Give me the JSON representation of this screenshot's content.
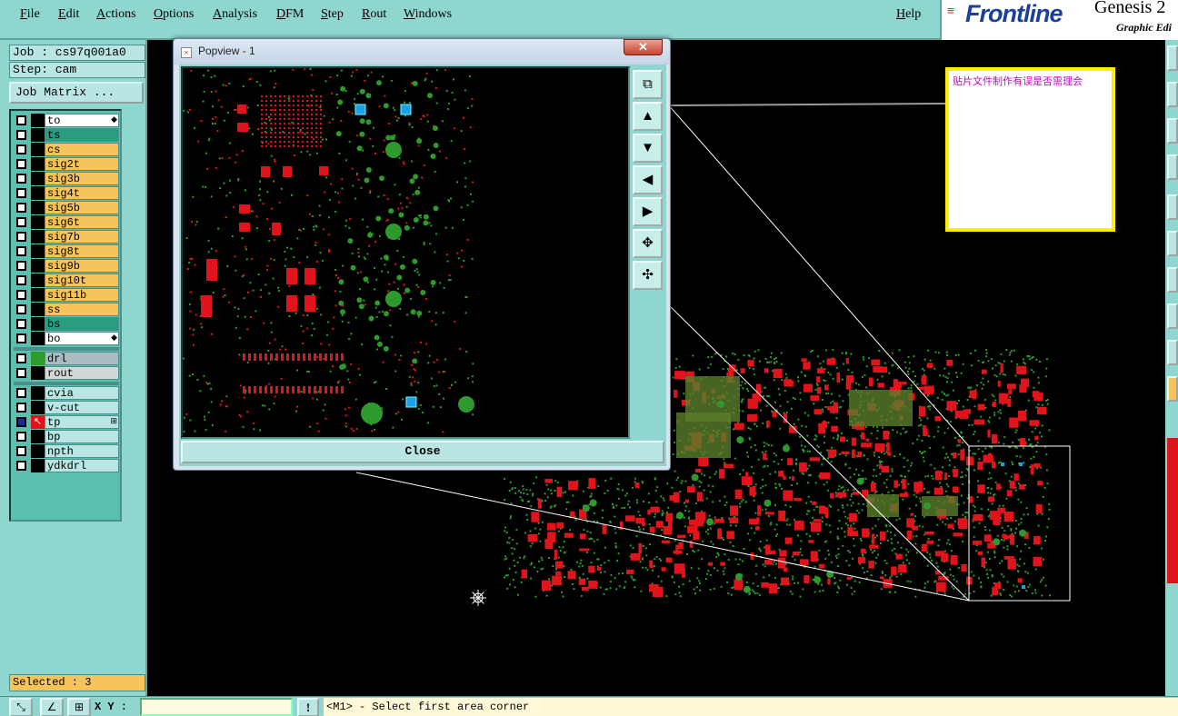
{
  "menubar": {
    "items": [
      "File",
      "Edit",
      "Actions",
      "Options",
      "Analysis",
      "DFM",
      "Step",
      "Rout",
      "Windows"
    ],
    "help": "Help"
  },
  "brand": {
    "logo": "Frontline",
    "product": "Genesis 2",
    "subtitle": "Graphic Edi"
  },
  "left_panel": {
    "job": "Job : cs97q001a0",
    "step": "Step: cam",
    "job_matrix_button": "Job Matrix ...",
    "layers_group1": [
      {
        "name": "to",
        "color": "#ffffff",
        "mark": "◆"
      },
      {
        "name": "ts",
        "color": "#2a9d80"
      },
      {
        "name": "cs",
        "color": "#f7c45b"
      },
      {
        "name": "sig2t",
        "color": "#f7c45b"
      },
      {
        "name": "sig3b",
        "color": "#f7c45b"
      },
      {
        "name": "sig4t",
        "color": "#f7c45b"
      },
      {
        "name": "sig5b",
        "color": "#f7c45b"
      },
      {
        "name": "sig6t",
        "color": "#f7c45b"
      },
      {
        "name": "sig7b",
        "color": "#f7c45b"
      },
      {
        "name": "sig8t",
        "color": "#f7c45b"
      },
      {
        "name": "sig9b",
        "color": "#f7c45b"
      },
      {
        "name": "sig10t",
        "color": "#f7c45b"
      },
      {
        "name": "sig11b",
        "color": "#f7c45b"
      },
      {
        "name": "ss",
        "color": "#f7c45b"
      },
      {
        "name": "bs",
        "color": "#2a9d80"
      },
      {
        "name": "bo",
        "color": "#ffffff",
        "mark": "◆"
      }
    ],
    "layers_group2": [
      {
        "name": "drl",
        "color": "#a9bcc2",
        "swatch": "#2a9d2a"
      },
      {
        "name": "rout",
        "color": "#d0d8d8"
      }
    ],
    "layers_group3": [
      {
        "name": "cvia",
        "color": "#b9e6e2"
      },
      {
        "name": "v-cut",
        "color": "#b9e6e2"
      },
      {
        "name": "tp",
        "color": "#b9e6e2",
        "active": true,
        "mark": "⊞"
      },
      {
        "name": "bp",
        "color": "#b9e6e2"
      },
      {
        "name": "npth",
        "color": "#b9e6e2"
      },
      {
        "name": "ydkdrl",
        "color": "#b9e6e2"
      }
    ],
    "selected": "Selected : 3"
  },
  "note": {
    "text": "贴片文件制作有误是否需理会"
  },
  "popview": {
    "title": "Popview - 1",
    "close_x": "✕",
    "close_button": "Close",
    "tools": [
      "zoom-fit-icon",
      "pan-up-icon",
      "pan-down-icon",
      "pan-left-icon",
      "pan-right-icon",
      "zoom-in-icon",
      "zoom-out-icon"
    ]
  },
  "status": {
    "xy_label": "X Y :",
    "xy_value": "",
    "prompt_button": "!",
    "prompt": "<M1> - Select first area corner"
  },
  "colors": {
    "panel": "#8fd6cf",
    "layer_signal": "#f7c45b",
    "layer_mask": "#2a9d80",
    "pad_red": "#e0141a",
    "pad_green": "#2e9a2e",
    "pad_blue": "#1ea0e6"
  }
}
